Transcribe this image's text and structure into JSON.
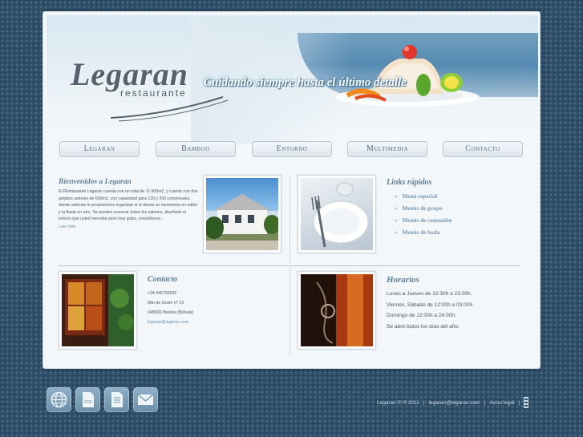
{
  "header": {
    "logo_name": "Legaran",
    "logo_sub": "restaurante",
    "tagline": "Cuidando siempre hasta el último detalle"
  },
  "nav": [
    {
      "label": "Legaran"
    },
    {
      "label": "Bamboo"
    },
    {
      "label": "Entorno"
    },
    {
      "label": "Multimedia"
    },
    {
      "label": "Contacto"
    }
  ],
  "welcome": {
    "title": "Bienvenidos a Legaran",
    "body": "El Restaurante Legaran cuenta con un total de 11.000m2, y cuenta con dos amplios salones de 600m2, con capacidad para 120 y 200 comensales, donde además le proponemos organizar si lo desea su ceremonia en salón y la fiesta en otro. Se pueden reservar todos los salones, diseñarle el evento que usted necesita será muy grato, consúltenos...",
    "more": "Leer más"
  },
  "links": {
    "title": "Links rápidos",
    "items": [
      "Menú especial",
      "Menús de grupo",
      "Menús de comunión",
      "Menús de boda"
    ]
  },
  "contact": {
    "title": "Contacto",
    "lines": [
      "+34 946793296",
      "Alto de Goieri nº 13",
      "(48650) Barrika (Bizkaia)"
    ],
    "email": "legaran@legaran.com"
  },
  "hours": {
    "title": "Horarios",
    "lines": [
      "Lunes a Jueves de 12:30h a 23:00h.",
      "Viernes, Sábado de 12:00h a 03:00h.",
      "Domingo de 12:00h a 24:00h.",
      "Se abre todos los días del año."
    ]
  },
  "footer": {
    "copyright": "Legaran © ® 2011",
    "email": "legaran@legaran.com",
    "legal": "Aviso legal",
    "icons": [
      "globe-icon",
      "pdf-icon",
      "document-icon",
      "mail-icon"
    ]
  },
  "colors": {
    "accent": "#5d7f9b",
    "background": "#2e4d66",
    "panel": "#f4f7f9"
  }
}
